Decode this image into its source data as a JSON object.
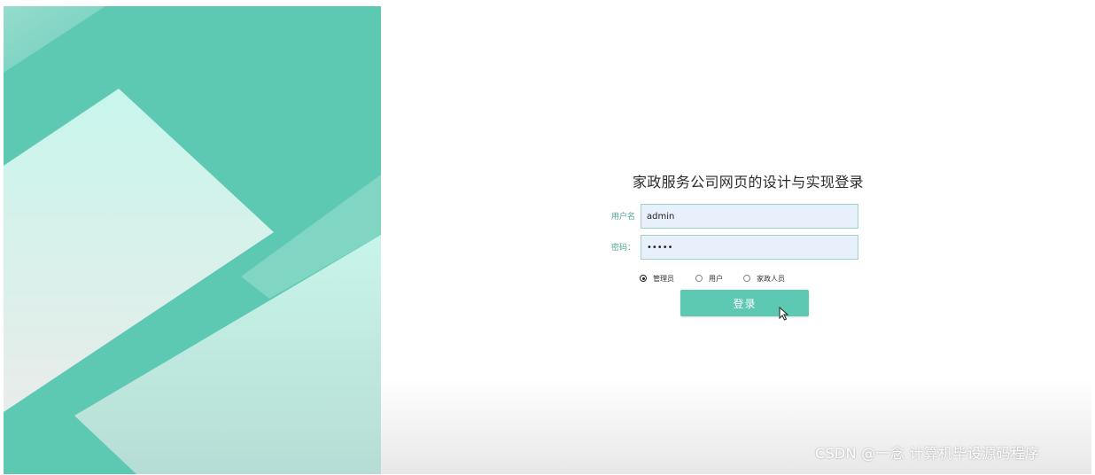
{
  "login": {
    "title": "家政服务公司网页的设计与实现登录",
    "username_label": "用户名",
    "username_value": "admin",
    "password_label": "密码：",
    "password_value": "•••••",
    "roles": [
      {
        "label": "管理员",
        "checked": true
      },
      {
        "label": "用户",
        "checked": false
      },
      {
        "label": "家政人员",
        "checked": false
      }
    ],
    "submit_label": "登录"
  },
  "watermark": "CSDN @一念 计算机毕设源码程序",
  "colors": {
    "accent": "#5dc9b2",
    "input_bg": "#e8f0fb",
    "input_border": "#9fd3c7",
    "label": "#4aa893"
  }
}
